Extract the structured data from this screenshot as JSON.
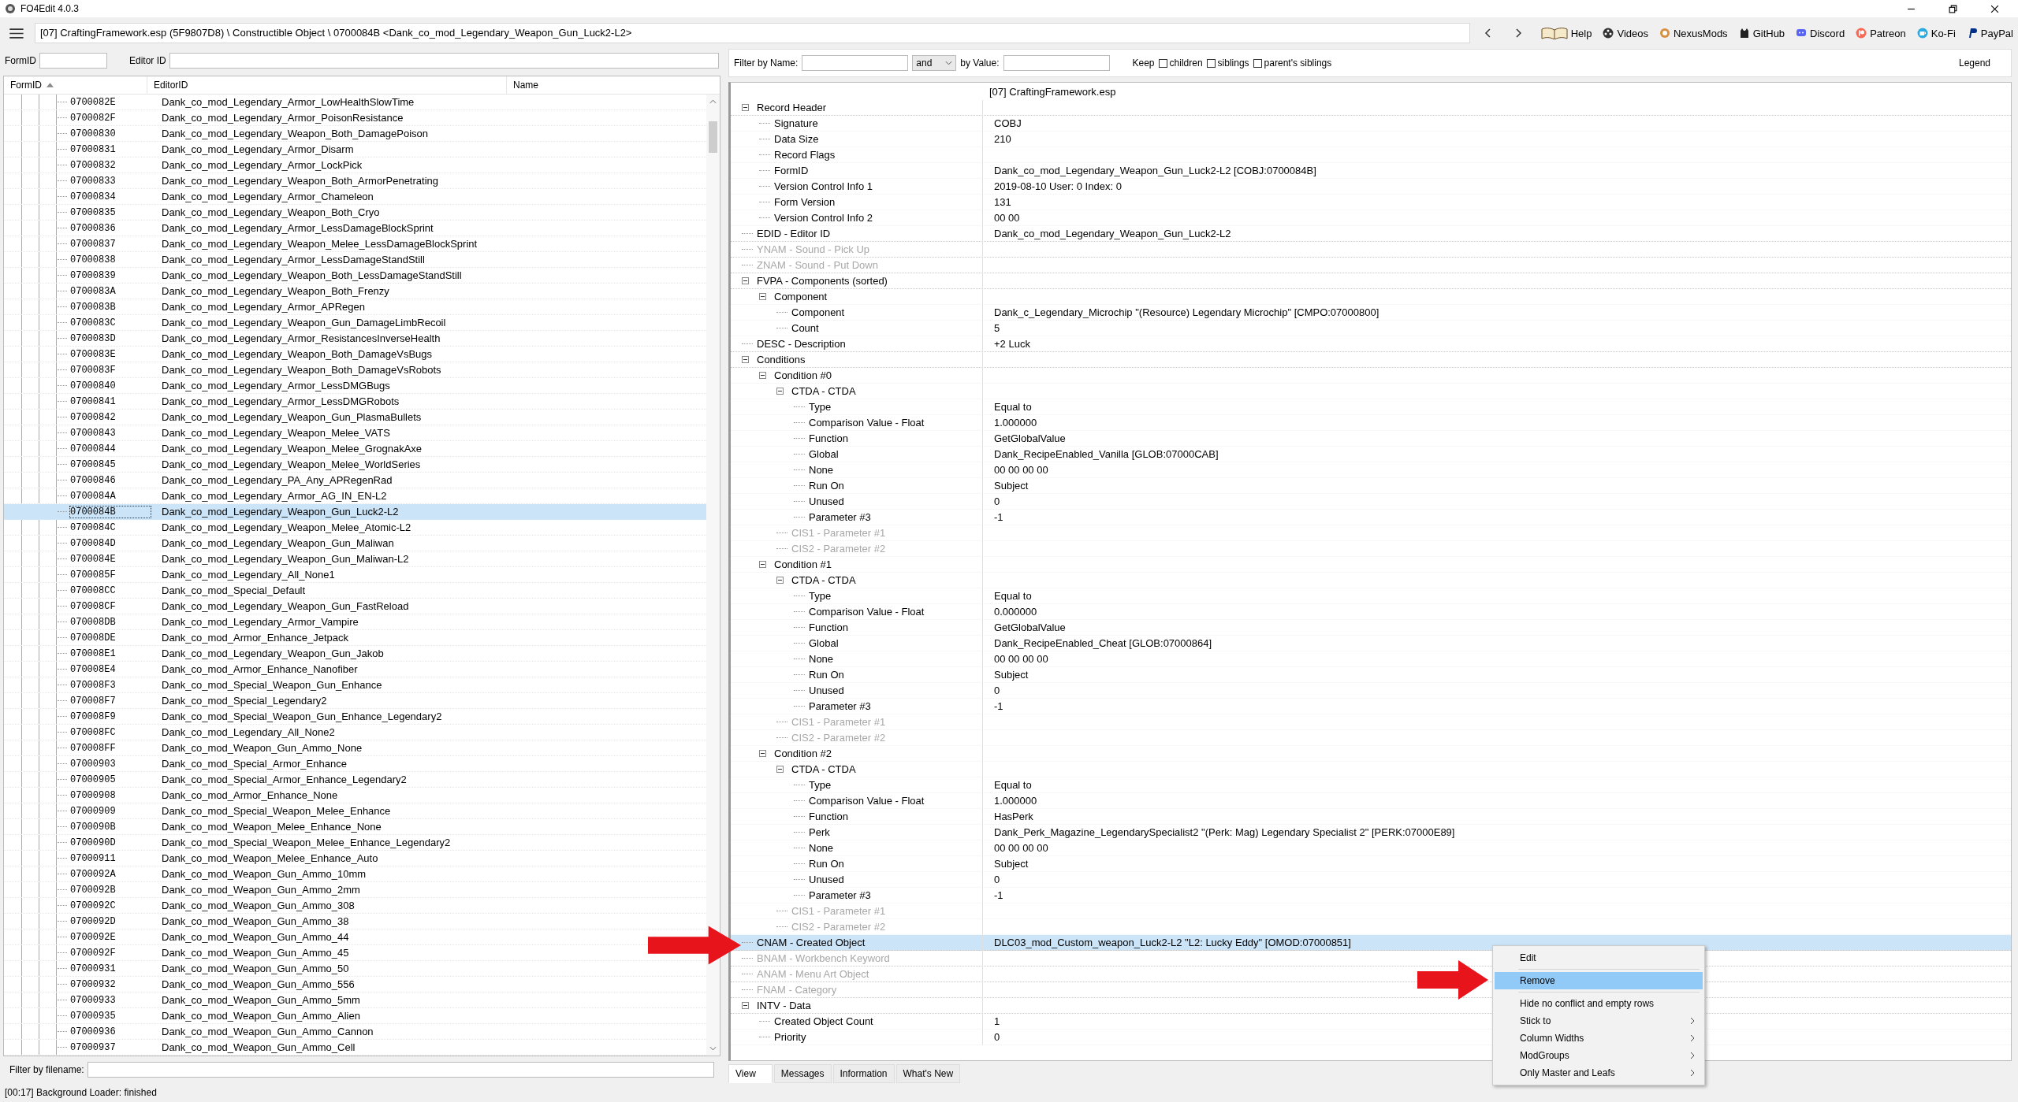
{
  "window": {
    "title": "FO4Edit 4.0.3"
  },
  "nav": {
    "path": "[07] CraftingFramework.esp (5F9807D8) \\ Constructible Object \\ 0700084B <Dank_co_mod_Legendary_Weapon_Gun_Luck2-L2>",
    "links": [
      {
        "label": "Help",
        "kind": "book"
      },
      {
        "label": "Videos",
        "kind": "film"
      },
      {
        "label": "NexusMods",
        "kind": "nexus"
      },
      {
        "label": "GitHub",
        "kind": "cat"
      },
      {
        "label": "Discord",
        "kind": "chat"
      },
      {
        "label": "Patreon",
        "kind": "patreon"
      },
      {
        "label": "Ko-Fi",
        "kind": "cup"
      },
      {
        "label": "PayPal",
        "kind": "pay"
      }
    ]
  },
  "id_filters": {
    "form_id_label": "FormID",
    "editor_id_label": "Editor ID"
  },
  "record_list": {
    "columns": [
      "FormID",
      "EditorID",
      "Name"
    ],
    "rows": [
      {
        "form_id": "0700082E",
        "editor_id": "Dank_co_mod_Legendary_Armor_LowHealthSlowTime",
        "selected": false
      },
      {
        "form_id": "0700082F",
        "editor_id": "Dank_co_mod_Legendary_Armor_PoisonResistance",
        "selected": false
      },
      {
        "form_id": "07000830",
        "editor_id": "Dank_co_mod_Legendary_Weapon_Both_DamagePoison",
        "selected": false
      },
      {
        "form_id": "07000831",
        "editor_id": "Dank_co_mod_Legendary_Armor_Disarm",
        "selected": false
      },
      {
        "form_id": "07000832",
        "editor_id": "Dank_co_mod_Legendary_Armor_LockPick",
        "selected": false
      },
      {
        "form_id": "07000833",
        "editor_id": "Dank_co_mod_Legendary_Weapon_Both_ArmorPenetrating",
        "selected": false
      },
      {
        "form_id": "07000834",
        "editor_id": "Dank_co_mod_Legendary_Armor_Chameleon",
        "selected": false
      },
      {
        "form_id": "07000835",
        "editor_id": "Dank_co_mod_Legendary_Weapon_Both_Cryo",
        "selected": false
      },
      {
        "form_id": "07000836",
        "editor_id": "Dank_co_mod_Legendary_Armor_LessDamageBlockSprint",
        "selected": false
      },
      {
        "form_id": "07000837",
        "editor_id": "Dank_co_mod_Legendary_Weapon_Melee_LessDamageBlockSprint",
        "selected": false
      },
      {
        "form_id": "07000838",
        "editor_id": "Dank_co_mod_Legendary_Armor_LessDamageStandStill",
        "selected": false
      },
      {
        "form_id": "07000839",
        "editor_id": "Dank_co_mod_Legendary_Weapon_Both_LessDamageStandStill",
        "selected": false
      },
      {
        "form_id": "0700083A",
        "editor_id": "Dank_co_mod_Legendary_Weapon_Both_Frenzy",
        "selected": false
      },
      {
        "form_id": "0700083B",
        "editor_id": "Dank_co_mod_Legendary_Armor_APRegen",
        "selected": false
      },
      {
        "form_id": "0700083C",
        "editor_id": "Dank_co_mod_Legendary_Weapon_Gun_DamageLimbRecoil",
        "selected": false
      },
      {
        "form_id": "0700083D",
        "editor_id": "Dank_co_mod_Legendary_Armor_ResistancesInverseHealth",
        "selected": false
      },
      {
        "form_id": "0700083E",
        "editor_id": "Dank_co_mod_Legendary_Weapon_Both_DamageVsBugs",
        "selected": false
      },
      {
        "form_id": "0700083F",
        "editor_id": "Dank_co_mod_Legendary_Weapon_Both_DamageVsRobots",
        "selected": false
      },
      {
        "form_id": "07000840",
        "editor_id": "Dank_co_mod_Legendary_Armor_LessDMGBugs",
        "selected": false
      },
      {
        "form_id": "07000841",
        "editor_id": "Dank_co_mod_Legendary_Armor_LessDMGRobots",
        "selected": false
      },
      {
        "form_id": "07000842",
        "editor_id": "Dank_co_mod_Legendary_Weapon_Gun_PlasmaBullets",
        "selected": false
      },
      {
        "form_id": "07000843",
        "editor_id": "Dank_co_mod_Legendary_Weapon_Melee_VATS",
        "selected": false
      },
      {
        "form_id": "07000844",
        "editor_id": "Dank_co_mod_Legendary_Weapon_Melee_GrognakAxe",
        "selected": false
      },
      {
        "form_id": "07000845",
        "editor_id": "Dank_co_mod_Legendary_Weapon_Melee_WorldSeries",
        "selected": false
      },
      {
        "form_id": "07000846",
        "editor_id": "Dank_co_mod_Legendary_PA_Any_APRegenRad",
        "selected": false
      },
      {
        "form_id": "0700084A",
        "editor_id": "Dank_co_mod_Legendary_Armor_AG_IN_EN-L2",
        "selected": false
      },
      {
        "form_id": "0700084B",
        "editor_id": "Dank_co_mod_Legendary_Weapon_Gun_Luck2-L2",
        "selected": true
      },
      {
        "form_id": "0700084C",
        "editor_id": "Dank_co_mod_Legendary_Weapon_Melee_Atomic-L2",
        "selected": false
      },
      {
        "form_id": "0700084D",
        "editor_id": "Dank_co_mod_Legendary_Weapon_Gun_Maliwan",
        "selected": false
      },
      {
        "form_id": "0700084E",
        "editor_id": "Dank_co_mod_Legendary_Weapon_Gun_Maliwan-L2",
        "selected": false
      },
      {
        "form_id": "0700085F",
        "editor_id": "Dank_co_mod_Legendary_All_None1",
        "selected": false
      },
      {
        "form_id": "070008CC",
        "editor_id": "Dank_co_mod_Special_Default",
        "selected": false
      },
      {
        "form_id": "070008CF",
        "editor_id": "Dank_co_mod_Legendary_Weapon_Gun_FastReload",
        "selected": false
      },
      {
        "form_id": "070008DB",
        "editor_id": "Dank_co_mod_Legendary_Armor_Vampire",
        "selected": false
      },
      {
        "form_id": "070008DE",
        "editor_id": "Dank_co_mod_Armor_Enhance_Jetpack",
        "selected": false
      },
      {
        "form_id": "070008E1",
        "editor_id": "Dank_co_mod_Legendary_Weapon_Gun_Jakob",
        "selected": false
      },
      {
        "form_id": "070008E4",
        "editor_id": "Dank_co_mod_Armor_Enhance_Nanofiber",
        "selected": false
      },
      {
        "form_id": "070008F3",
        "editor_id": "Dank_co_mod_Special_Weapon_Gun_Enhance",
        "selected": false
      },
      {
        "form_id": "070008F7",
        "editor_id": "Dank_co_mod_Special_Legendary2",
        "selected": false
      },
      {
        "form_id": "070008F9",
        "editor_id": "Dank_co_mod_Special_Weapon_Gun_Enhance_Legendary2",
        "selected": false
      },
      {
        "form_id": "070008FC",
        "editor_id": "Dank_co_mod_Legendary_All_None2",
        "selected": false
      },
      {
        "form_id": "070008FF",
        "editor_id": "Dank_co_mod_Weapon_Gun_Ammo_None",
        "selected": false
      },
      {
        "form_id": "07000903",
        "editor_id": "Dank_co_mod_Special_Armor_Enhance",
        "selected": false
      },
      {
        "form_id": "07000905",
        "editor_id": "Dank_co_mod_Special_Armor_Enhance_Legendary2",
        "selected": false
      },
      {
        "form_id": "07000908",
        "editor_id": "Dank_co_mod_Armor_Enhance_None",
        "selected": false
      },
      {
        "form_id": "07000909",
        "editor_id": "Dank_co_mod_Special_Weapon_Melee_Enhance",
        "selected": false
      },
      {
        "form_id": "0700090B",
        "editor_id": "Dank_co_mod_Weapon_Melee_Enhance_None",
        "selected": false
      },
      {
        "form_id": "0700090D",
        "editor_id": "Dank_co_mod_Special_Weapon_Melee_Enhance_Legendary2",
        "selected": false
      },
      {
        "form_id": "07000911",
        "editor_id": "Dank_co_mod_Weapon_Melee_Enhance_Auto",
        "selected": false
      },
      {
        "form_id": "0700092A",
        "editor_id": "Dank_co_mod_Weapon_Gun_Ammo_10mm",
        "selected": false
      },
      {
        "form_id": "0700092B",
        "editor_id": "Dank_co_mod_Weapon_Gun_Ammo_2mm",
        "selected": false
      },
      {
        "form_id": "0700092C",
        "editor_id": "Dank_co_mod_Weapon_Gun_Ammo_308",
        "selected": false
      },
      {
        "form_id": "0700092D",
        "editor_id": "Dank_co_mod_Weapon_Gun_Ammo_38",
        "selected": false
      },
      {
        "form_id": "0700092E",
        "editor_id": "Dank_co_mod_Weapon_Gun_Ammo_44",
        "selected": false
      },
      {
        "form_id": "0700092F",
        "editor_id": "Dank_co_mod_Weapon_Gun_Ammo_45",
        "selected": false
      },
      {
        "form_id": "07000931",
        "editor_id": "Dank_co_mod_Weapon_Gun_Ammo_50",
        "selected": false
      },
      {
        "form_id": "07000932",
        "editor_id": "Dank_co_mod_Weapon_Gun_Ammo_556",
        "selected": false
      },
      {
        "form_id": "07000933",
        "editor_id": "Dank_co_mod_Weapon_Gun_Ammo_5mm",
        "selected": false
      },
      {
        "form_id": "07000935",
        "editor_id": "Dank_co_mod_Weapon_Gun_Ammo_Alien",
        "selected": false
      },
      {
        "form_id": "07000936",
        "editor_id": "Dank_co_mod_Weapon_Gun_Ammo_Cannon",
        "selected": false
      },
      {
        "form_id": "07000937",
        "editor_id": "Dank_co_mod_Weapon_Gun_Ammo_Cell",
        "selected": false
      }
    ]
  },
  "file_filter": {
    "label": "Filter by filename:"
  },
  "view_filter": {
    "name_label": "Filter by Name:",
    "operator": "and",
    "value_label": "by Value:",
    "keep_label": "Keep",
    "options": [
      {
        "label": "children",
        "checked": false
      },
      {
        "label": "siblings",
        "checked": false
      },
      {
        "label": "parent's siblings",
        "checked": false
      }
    ],
    "legend": "Legend"
  },
  "record_view": {
    "header": "[07] CraftingFramework.esp",
    "rows": [
      {
        "label": "Record Header",
        "expanded": true,
        "disabled": false,
        "selected": false,
        "children": [
          {
            "label": "Signature",
            "value": "COBJ",
            "disabled": false,
            "selected": false
          },
          {
            "label": "Data Size",
            "value": "210",
            "disabled": false,
            "selected": false
          },
          {
            "label": "Record Flags",
            "disabled": false,
            "selected": false
          },
          {
            "label": "FormID",
            "value": "Dank_co_mod_Legendary_Weapon_Gun_Luck2-L2 [COBJ:0700084B]",
            "disabled": false,
            "selected": false
          },
          {
            "label": "Version Control Info 1",
            "value": "2019-08-10 User: 0 Index: 0",
            "disabled": false,
            "selected": false
          },
          {
            "label": "Form Version",
            "value": "131",
            "disabled": false,
            "selected": false
          },
          {
            "label": "Version Control Info 2",
            "value": "00 00",
            "disabled": false,
            "selected": false
          }
        ]
      },
      {
        "label": "EDID - Editor ID",
        "value": "Dank_co_mod_Legendary_Weapon_Gun_Luck2-L2",
        "disabled": false,
        "selected": false
      },
      {
        "label": "YNAM - Sound - Pick Up",
        "disabled": true,
        "selected": false
      },
      {
        "label": "ZNAM - Sound - Put Down",
        "disabled": true,
        "selected": false
      },
      {
        "label": "FVPA - Components (sorted)",
        "expanded": true,
        "disabled": false,
        "selected": false,
        "children": [
          {
            "label": "Component",
            "expanded": true,
            "disabled": false,
            "selected": false,
            "children": [
              {
                "label": "Component",
                "value": "Dank_c_Legendary_Microchip \"(Resource) Legendary Microchip\" [CMPO:07000800]",
                "disabled": false,
                "selected": false
              },
              {
                "label": "Count",
                "value": "5",
                "disabled": false,
                "selected": false
              }
            ]
          }
        ]
      },
      {
        "label": "DESC - Description",
        "value": "+2 Luck",
        "disabled": false,
        "selected": false
      },
      {
        "label": "Conditions",
        "expanded": true,
        "disabled": false,
        "selected": false,
        "children": [
          {
            "label": "Condition #0",
            "expanded": true,
            "disabled": false,
            "selected": false,
            "children": [
              {
                "label": "CTDA - CTDA",
                "expanded": true,
                "disabled": false,
                "selected": false,
                "children": [
                  {
                    "label": "Type",
                    "value": "Equal to",
                    "disabled": false,
                    "selected": false
                  },
                  {
                    "label": "Comparison Value - Float",
                    "value": "1.000000",
                    "disabled": false,
                    "selected": false
                  },
                  {
                    "label": "Function",
                    "value": "GetGlobalValue",
                    "disabled": false,
                    "selected": false
                  },
                  {
                    "label": "Global",
                    "value": "Dank_RecipeEnabled_Vanilla [GLOB:07000CAB]",
                    "disabled": false,
                    "selected": false
                  },
                  {
                    "label": "None",
                    "value": "00 00 00 00",
                    "disabled": false,
                    "selected": false
                  },
                  {
                    "label": "Run On",
                    "value": "Subject",
                    "disabled": false,
                    "selected": false
                  },
                  {
                    "label": "Unused",
                    "value": "0",
                    "disabled": false,
                    "selected": false
                  },
                  {
                    "label": "Parameter #3",
                    "value": "-1",
                    "disabled": false,
                    "selected": false
                  }
                ]
              },
              {
                "label": "CIS1 - Parameter #1",
                "disabled": true,
                "selected": false
              },
              {
                "label": "CIS2 - Parameter #2",
                "disabled": true,
                "selected": false
              }
            ]
          },
          {
            "label": "Condition #1",
            "expanded": true,
            "disabled": false,
            "selected": false,
            "children": [
              {
                "label": "CTDA - CTDA",
                "expanded": true,
                "disabled": false,
                "selected": false,
                "children": [
                  {
                    "label": "Type",
                    "value": "Equal to",
                    "disabled": false,
                    "selected": false
                  },
                  {
                    "label": "Comparison Value - Float",
                    "value": "0.000000",
                    "disabled": false,
                    "selected": false
                  },
                  {
                    "label": "Function",
                    "value": "GetGlobalValue",
                    "disabled": false,
                    "selected": false
                  },
                  {
                    "label": "Global",
                    "value": "Dank_RecipeEnabled_Cheat [GLOB:07000864]",
                    "disabled": false,
                    "selected": false
                  },
                  {
                    "label": "None",
                    "value": "00 00 00 00",
                    "disabled": false,
                    "selected": false
                  },
                  {
                    "label": "Run On",
                    "value": "Subject",
                    "disabled": false,
                    "selected": false
                  },
                  {
                    "label": "Unused",
                    "value": "0",
                    "disabled": false,
                    "selected": false
                  },
                  {
                    "label": "Parameter #3",
                    "value": "-1",
                    "disabled": false,
                    "selected": false
                  }
                ]
              },
              {
                "label": "CIS1 - Parameter #1",
                "disabled": true,
                "selected": false
              },
              {
                "label": "CIS2 - Parameter #2",
                "disabled": true,
                "selected": false
              }
            ]
          },
          {
            "label": "Condition #2",
            "expanded": true,
            "disabled": false,
            "selected": false,
            "children": [
              {
                "label": "CTDA - CTDA",
                "expanded": true,
                "disabled": false,
                "selected": false,
                "children": [
                  {
                    "label": "Type",
                    "value": "Equal to",
                    "disabled": false,
                    "selected": false
                  },
                  {
                    "label": "Comparison Value - Float",
                    "value": "1.000000",
                    "disabled": false,
                    "selected": false
                  },
                  {
                    "label": "Function",
                    "value": "HasPerk",
                    "disabled": false,
                    "selected": false
                  },
                  {
                    "label": "Perk",
                    "value": "Dank_Perk_Magazine_LegendarySpecialist2 \"(Perk: Mag) Legendary Specialist 2\" [PERK:07000E89]",
                    "disabled": false,
                    "selected": false
                  },
                  {
                    "label": "None",
                    "value": "00 00 00 00",
                    "disabled": false,
                    "selected": false
                  },
                  {
                    "label": "Run On",
                    "value": "Subject",
                    "disabled": false,
                    "selected": false
                  },
                  {
                    "label": "Unused",
                    "value": "0",
                    "disabled": false,
                    "selected": false
                  },
                  {
                    "label": "Parameter #3",
                    "value": "-1",
                    "disabled": false,
                    "selected": false
                  }
                ]
              },
              {
                "label": "CIS1 - Parameter #1",
                "disabled": true,
                "selected": false
              },
              {
                "label": "CIS2 - Parameter #2",
                "disabled": true,
                "selected": false
              }
            ]
          }
        ]
      },
      {
        "label": "CNAM - Created Object",
        "value": "DLC03_mod_Custom_weapon_Luck2-L2 \"L2: Lucky Eddy\" [OMOD:07000851]",
        "disabled": false,
        "selected": true
      },
      {
        "label": "BNAM - Workbench Keyword",
        "disabled": true,
        "selected": false
      },
      {
        "label": "ANAM - Menu Art Object",
        "disabled": true,
        "selected": false
      },
      {
        "label": "FNAM - Category",
        "disabled": true,
        "selected": false
      },
      {
        "label": "INTV - Data",
        "expanded": true,
        "disabled": false,
        "selected": false,
        "children": [
          {
            "label": "Created Object Count",
            "value": "1",
            "disabled": false,
            "selected": false
          },
          {
            "label": "Priority",
            "value": "0",
            "disabled": false,
            "selected": false
          }
        ]
      }
    ]
  },
  "bottom_tabs": [
    {
      "label": "View",
      "selected": true
    },
    {
      "label": "Messages",
      "selected": false
    },
    {
      "label": "Information",
      "selected": false
    },
    {
      "label": "What's New",
      "selected": false
    }
  ],
  "context_menu": {
    "items": [
      {
        "kind": "command",
        "label": "Edit",
        "selected": false
      },
      {
        "kind": "separator"
      },
      {
        "kind": "command",
        "label": "Remove",
        "selected": true
      },
      {
        "kind": "separator"
      },
      {
        "kind": "command",
        "label": "Hide no conflict and empty rows",
        "selected": false
      },
      {
        "kind": "submenu",
        "label": "Stick to",
        "selected": false
      },
      {
        "kind": "submenu",
        "label": "Column Widths",
        "selected": false
      },
      {
        "kind": "submenu",
        "label": "ModGroups",
        "selected": false
      },
      {
        "kind": "submenu",
        "label": "Only Master and Leafs",
        "selected": false
      }
    ]
  },
  "status_bar": {
    "text": "[00:17] Background Loader: finished"
  }
}
